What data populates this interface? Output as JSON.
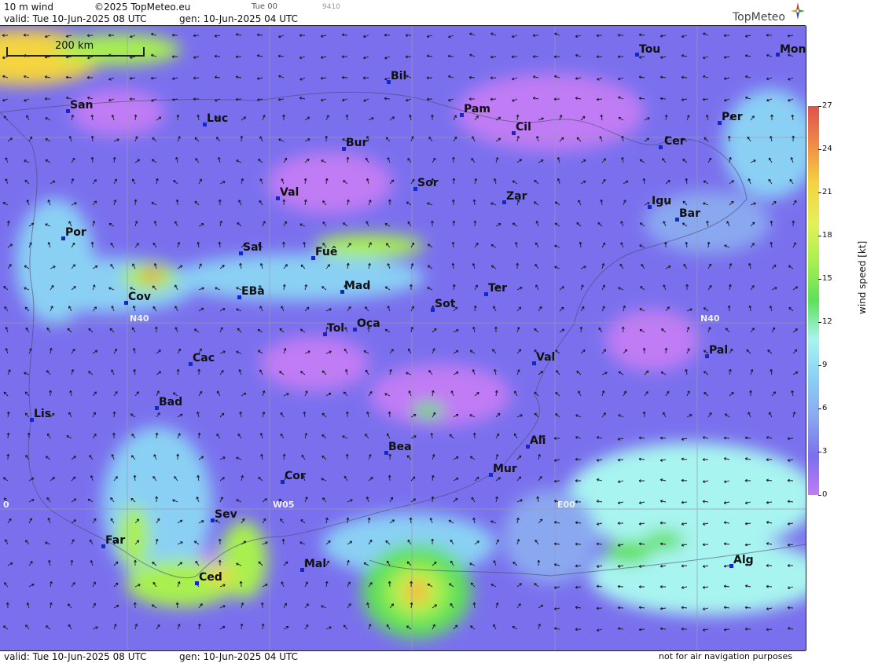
{
  "header": {
    "parameter": "10 m wind",
    "copyright": "©2025 TopMeteo.eu",
    "step": "Tue 00",
    "code": "9410",
    "valid": "valid:  Tue  10-Jun-2025  08 UTC",
    "generated": "gen: 10-Jun-2025 04 UTC",
    "logo": "TopMeteo"
  },
  "footer": {
    "valid": "valid:  Tue  10-Jun-2025  08 UTC",
    "generated": "gen: 10-Jun-2025 04 UTC",
    "disclaimer": "not for air navigation purposes"
  },
  "scale": {
    "label": "200 km"
  },
  "grid_labels": [
    "N40",
    "N40",
    "W05",
    "E00",
    "0"
  ],
  "cities": [
    "Tou",
    "Mon",
    "Bil",
    "San",
    "Pam",
    "Luc",
    "Cil",
    "Per",
    "Cer",
    "Bur",
    "Sor",
    "Val",
    "Zar",
    "Igu",
    "Bar",
    "Por",
    "Sal",
    "Fuê",
    "Cov",
    "EBa",
    "Mad",
    "Ter",
    "Sot",
    "Tol",
    "Oca",
    "Pal",
    "Cac",
    "Val",
    "Bad",
    "Lis",
    "Ali",
    "Bea",
    "Mur",
    "Cor",
    "Sev",
    "Far",
    "Alg",
    "Mal",
    "Ced"
  ],
  "legend": {
    "title": "wind speed  [kt]",
    "ticks": [
      "27",
      "24",
      "21",
      "18",
      "15",
      "12",
      "9",
      "6",
      "3",
      "0"
    ],
    "colors": [
      "#e05050",
      "#f08c46",
      "#f4d440",
      "#e4f05a",
      "#a8f050",
      "#5ee05a",
      "#a8f4f0",
      "#8ad0f4",
      "#8aa8f0",
      "#7a70ee",
      "#c07cf4"
    ]
  }
}
